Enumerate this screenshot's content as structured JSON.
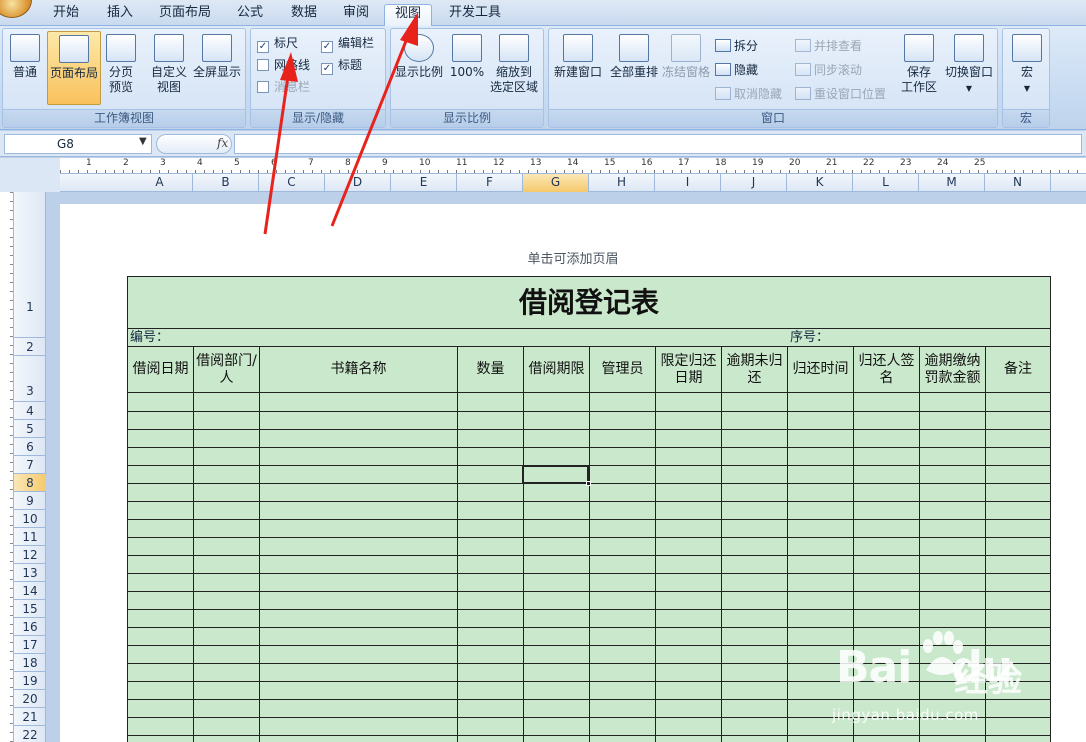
{
  "tabs": [
    "开始",
    "插入",
    "页面布局",
    "公式",
    "数据",
    "审阅",
    "视图",
    "开发工具"
  ],
  "active_tab": "视图",
  "ribbon": {
    "workbook_views": {
      "label": "工作簿视图",
      "normal": "普通",
      "page_layout": "页面布局",
      "page_break_1": "分页",
      "page_break_2": "预览",
      "custom_1": "自定义",
      "custom_2": "视图",
      "full_screen": "全屏显示"
    },
    "show_hide": {
      "label": "显示/隐藏",
      "ruler": "标尺",
      "ruler_checked": true,
      "gridlines": "网格线",
      "gridlines_checked": false,
      "message_bar": "消息栏",
      "formula_bar": "编辑栏",
      "formula_bar_checked": true,
      "headings": "标题",
      "headings_checked": true
    },
    "zoom": {
      "label": "显示比例",
      "zoom": "显示比例",
      "hundred": "100%",
      "zoom_sel_1": "缩放到",
      "zoom_sel_2": "选定区域"
    },
    "window": {
      "label": "窗口",
      "new_window": "新建窗口",
      "arrange_all": "全部重排",
      "freeze_panes": "冻结窗格",
      "split": "拆分",
      "hide": "隐藏",
      "unhide": "取消隐藏",
      "side_by_side": "并排查看",
      "sync_scroll": "同步滚动",
      "reset_position": "重设窗口位置",
      "save_workspace_1": "保存",
      "save_workspace_2": "工作区",
      "switch_windows": "切换窗口"
    },
    "macros": {
      "label": "宏",
      "macros": "宏"
    }
  },
  "formula_bar": {
    "name_box": "G8",
    "fx": "fx",
    "content": ""
  },
  "ruler_numbers": [
    "1",
    "2",
    "3",
    "4",
    "5",
    "6",
    "7",
    "8",
    "9",
    "10",
    "11",
    "12",
    "13",
    "14",
    "15",
    "16",
    "17",
    "18",
    "19",
    "20",
    "21",
    "22",
    "23",
    "24",
    "25"
  ],
  "columns": [
    "A",
    "B",
    "C",
    "D",
    "E",
    "F",
    "G",
    "H",
    "I",
    "J",
    "K",
    "L",
    "M",
    "N"
  ],
  "selected_column": "G",
  "rows": [
    "1",
    "2",
    "3",
    "4",
    "5",
    "6",
    "7",
    "8",
    "9",
    "10",
    "11",
    "12",
    "13",
    "14",
    "15",
    "16",
    "17",
    "18",
    "19",
    "20",
    "21",
    "22"
  ],
  "selected_row": "8",
  "page": {
    "header_hint": "单击可添加页眉"
  },
  "sheet": {
    "title": "借阅登记表",
    "number_label": "编号：",
    "serial_label": "序号：",
    "headers": [
      "借阅日期",
      "借阅部门/人",
      "书籍名称",
      "数量",
      "借阅期限",
      "管理员",
      "限定归还日期",
      "逾期未归还",
      "归还时间",
      "归还人签名",
      "逾期缴纳罚款金额",
      "备注"
    ],
    "fill_color": "#cae8cc"
  },
  "watermark": {
    "logo": "Bai",
    "logo_tail": "du",
    "brand_cn": "经验",
    "url": "jingyan.baidu.com"
  },
  "annotation_color": "#e8231c"
}
